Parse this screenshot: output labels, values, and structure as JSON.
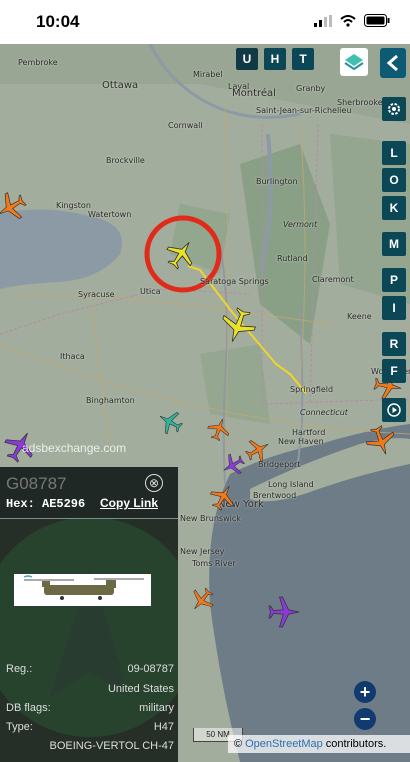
{
  "status_bar": {
    "time": "10:04"
  },
  "top_buttons": [
    "U",
    "H",
    "T"
  ],
  "side_buttons": [
    "L",
    "O",
    "K",
    "M",
    "P",
    "I",
    "R",
    "F"
  ],
  "cities": [
    {
      "name": "Pembroke"
    },
    {
      "name": "Ottawa"
    },
    {
      "name": "Mirabel"
    },
    {
      "name": "Laval"
    },
    {
      "name": "Montréal"
    },
    {
      "name": "Granby"
    },
    {
      "name": "Saint-Jean-sur-Richelieu"
    },
    {
      "name": "Sherbrooke"
    },
    {
      "name": "Cornwall"
    },
    {
      "name": "Brockville"
    },
    {
      "name": "Burlington"
    },
    {
      "name": "Kingston"
    },
    {
      "name": "Watertown"
    },
    {
      "name": "Syracuse"
    },
    {
      "name": "Utica"
    },
    {
      "name": "Saratoga Springs"
    },
    {
      "name": "Rutland"
    },
    {
      "name": "Keene"
    },
    {
      "name": "Claremont"
    },
    {
      "name": "Ithaca"
    },
    {
      "name": "Binghamton"
    },
    {
      "name": "Springfield"
    },
    {
      "name": "Worcester"
    },
    {
      "name": "Hartford"
    },
    {
      "name": "New Haven"
    },
    {
      "name": "Bridgeport"
    },
    {
      "name": "Brentwood"
    },
    {
      "name": "Long Island"
    },
    {
      "name": "New York"
    },
    {
      "name": "New Brunswick"
    },
    {
      "name": "Toms River"
    },
    {
      "name": "New Jersey"
    },
    {
      "name": "Connecticut"
    },
    {
      "name": "Vermont"
    }
  ],
  "watermark": "adsbexchange.com",
  "aircraft_panel": {
    "callsign": "G08787",
    "hex_label": "Hex: AE5296",
    "copy_link": "Copy Link",
    "close_icon": "⊗",
    "details": [
      {
        "label": "Reg.:",
        "value": "09-08787"
      },
      {
        "label": "",
        "value": "United States"
      },
      {
        "label": "DB flags:",
        "value": "military"
      },
      {
        "label": "Type:",
        "value": "H47"
      },
      {
        "label": "",
        "value": "BOEING-VERTOL CH-47"
      }
    ]
  },
  "zoom": {
    "in": "+",
    "out": "−"
  },
  "scale_label": "50 NM",
  "attribution": {
    "prefix": "©",
    "link": "OpenStreetMap",
    "suffix": "contributors."
  },
  "colors": {
    "selected_plane": "#e8e22a",
    "track": "#f1d42a",
    "orange_plane": "#f07a1a",
    "purple_plane": "#8a3ad8",
    "teal_plane": "#2fb59a",
    "highlight_ring": "#e02a1a",
    "button_bg": "#0b4755"
  }
}
